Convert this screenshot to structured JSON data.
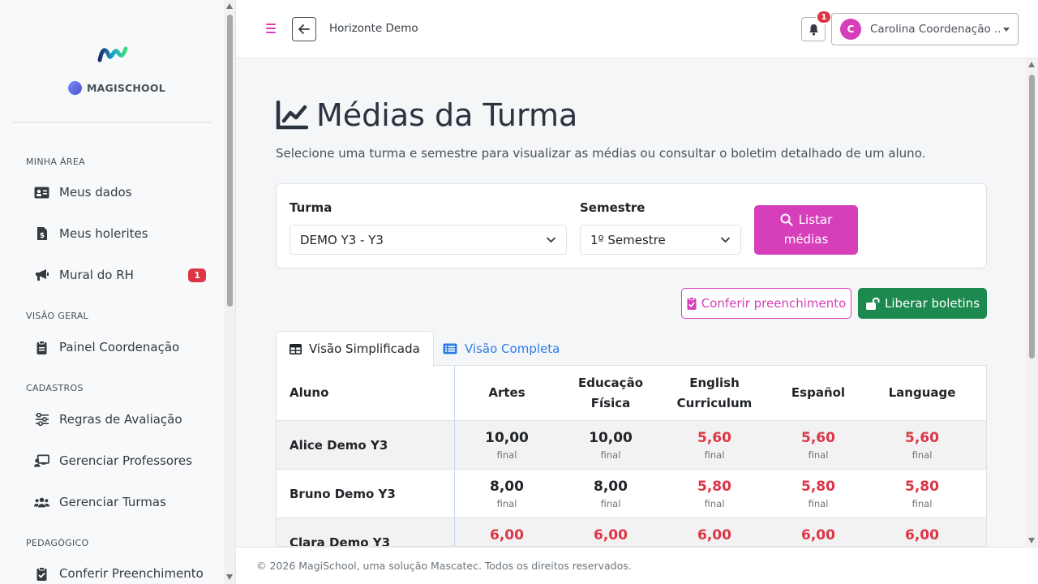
{
  "sidebar": {
    "brand": "MAGISCHOOL",
    "sections": [
      {
        "title": "MINHA ÁREA",
        "items": [
          {
            "label": "Meus dados",
            "icon": "id-card-icon"
          },
          {
            "label": "Meus holerites",
            "icon": "file-invoice-dollar-icon"
          },
          {
            "label": "Mural do RH",
            "icon": "megaphone-icon",
            "badge": "1"
          }
        ]
      },
      {
        "title": "VISÃO GERAL",
        "items": [
          {
            "label": "Painel Coordenação",
            "icon": "clipboard-icon"
          }
        ]
      },
      {
        "title": "CADASTROS",
        "items": [
          {
            "label": "Regras de Avaliação",
            "icon": "sliders-icon"
          },
          {
            "label": "Gerenciar Professores",
            "icon": "chalkboard-teacher-icon"
          },
          {
            "label": "Gerenciar Turmas",
            "icon": "users-icon"
          }
        ]
      },
      {
        "title": "PEDAGÓGICO",
        "items": [
          {
            "label": "Conferir Preenchimento",
            "icon": "clipboard-check-icon"
          }
        ]
      }
    ]
  },
  "topbar": {
    "org": "Horizonte Demo",
    "notifications": "1",
    "user_initial": "C",
    "user_name": "Carolina Coordenação ..."
  },
  "page": {
    "title": "Médias da Turma",
    "subtitle": "Selecione uma turma e semestre para visualizar as médias ou consultar o boletim detalhado de um aluno."
  },
  "filters": {
    "turma_label": "Turma",
    "turma_value": "DEMO Y3 - Y3",
    "semestre_label": "Semestre",
    "semestre_value": "1º Semestre",
    "list_button_line1": "Listar",
    "list_button_line2": "médias"
  },
  "actions": {
    "conferir": "Conferir preenchimento",
    "liberar": "Liberar boletins"
  },
  "tabs": {
    "simplificada": "Visão Simplificada",
    "completa": "Visão Completa"
  },
  "table": {
    "name_header": "Aluno",
    "subjects": [
      {
        "l1": "Artes",
        "l2": ""
      },
      {
        "l1": "Educação",
        "l2": "Física"
      },
      {
        "l1": "English",
        "l2": "Curriculum"
      },
      {
        "l1": "Español",
        "l2": ""
      },
      {
        "l1": "Language",
        "l2": ""
      }
    ],
    "final_label": "final",
    "rows": [
      {
        "name": "Alice Demo Y3",
        "grades": [
          "10,00",
          "10,00",
          "5,60",
          "5,60",
          "5,60"
        ],
        "below": [
          false,
          false,
          true,
          true,
          true
        ]
      },
      {
        "name": "Bruno Demo Y3",
        "grades": [
          "8,00",
          "8,00",
          "5,80",
          "5,80",
          "5,80"
        ],
        "below": [
          false,
          false,
          true,
          true,
          true
        ]
      },
      {
        "name": "Clara Demo Y3",
        "grades": [
          "6,00",
          "6,00",
          "6,00",
          "6,00",
          "6,00"
        ],
        "below": [
          true,
          true,
          true,
          true,
          true
        ]
      }
    ]
  },
  "footer": "© 2026 MagiSchool, uma solução Mascatec. Todos os direitos reservados.",
  "colors": {
    "accent": "#d63fb9",
    "success": "#1c8a4e",
    "danger": "#dc3545",
    "link": "#2b7de9"
  }
}
